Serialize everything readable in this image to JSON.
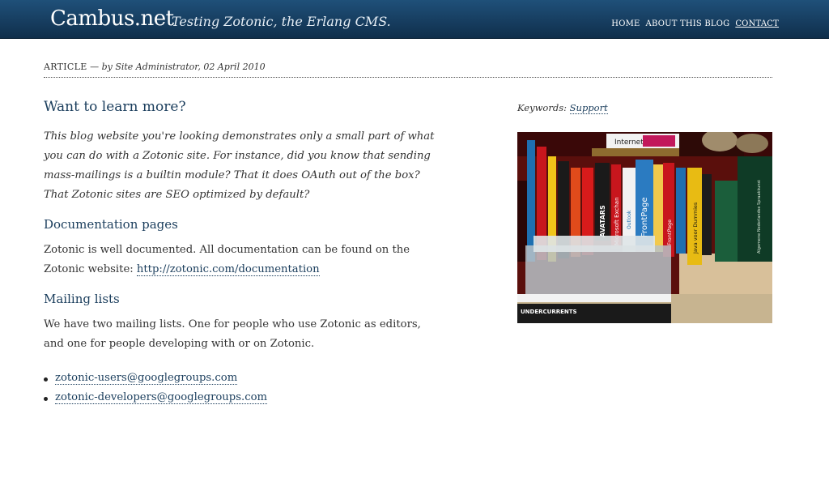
{
  "header": {
    "site_title": "Cambus.net",
    "tagline": "Testing Zotonic, the Erlang CMS.",
    "nav": [
      {
        "label": "HOME"
      },
      {
        "label": "ABOUT THIS BLOG"
      },
      {
        "label": "CONTACT",
        "active": true
      }
    ]
  },
  "meta": {
    "kind": "ARTICLE",
    "separator": " — ",
    "byline": "by Site Administrator, 02 April 2010"
  },
  "article": {
    "title": "Want to learn more?",
    "intro": "This blog website you're looking demonstrates only a small part of what you can do with a Zotonic site. For instance, did you know that sending mass-mailings is a builtin module? That it does OAuth out of the box? That Zotonic sites are SEO optimized by default?",
    "sections": [
      {
        "heading": "Documentation pages",
        "text": "Zotonic is well documented. All documentation can be found on the Zotonic website: ",
        "link": "http://zotonic.com/documentation"
      },
      {
        "heading": "Mailing lists",
        "text": "We have two mailing lists. One for people who use Zotonic as editors, and one for people developing with or on Zotonic.",
        "links": [
          "zotonic-users@googlegroups.com",
          "zotonic-developers@googlegroups.com"
        ]
      }
    ]
  },
  "sidebar": {
    "keywords_label": "Keywords:",
    "keyword": "Support",
    "photo": {
      "book_spines": [
        "Internet",
        "Microsoft Exchan",
        "AVATARS",
        "FrontPage",
        "Java voor Dummies",
        "Outlook",
        "FrontPage",
        "UNDERCURRENTS",
        "Algemene Nederlandse Spraakkunst",
        "PHOTOSHOP WEB MAG"
      ]
    }
  },
  "colors": {
    "header_bg": "#163c5e",
    "heading": "#1a3d5c",
    "text": "#333333"
  }
}
